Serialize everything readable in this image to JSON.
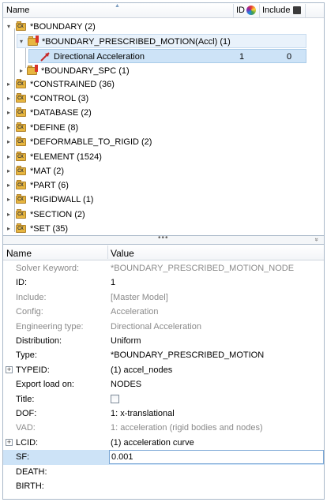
{
  "tree": {
    "columns": {
      "name": "Name",
      "id": "ID",
      "include": "Include"
    },
    "rows": [
      {
        "label": "*BOUNDARY  (2)",
        "state": "expanded"
      },
      {
        "label": "*BOUNDARY_PRESCRIBED_MOTION(Accl)  (1)",
        "state": "expanded"
      },
      {
        "label": "Directional Acceleration",
        "id": "1",
        "include": "0",
        "selected": true
      },
      {
        "label": "*BOUNDARY_SPC  (1)",
        "state": "collapsed"
      },
      {
        "label": "*CONSTRAINED  (36)",
        "state": "collapsed"
      },
      {
        "label": "*CONTROL  (3)",
        "state": "collapsed"
      },
      {
        "label": "*DATABASE  (2)",
        "state": "collapsed"
      },
      {
        "label": "*DEFINE  (8)",
        "state": "collapsed"
      },
      {
        "label": "*DEFORMABLE_TO_RIGID  (2)",
        "state": "collapsed"
      },
      {
        "label": "*ELEMENT  (1524)",
        "state": "collapsed"
      },
      {
        "label": "*MAT  (2)",
        "state": "collapsed"
      },
      {
        "label": "*PART  (6)",
        "state": "collapsed"
      },
      {
        "label": "*RIGIDWALL  (1)",
        "state": "collapsed"
      },
      {
        "label": "*SECTION  (2)",
        "state": "collapsed"
      },
      {
        "label": "*SET  (35)",
        "state": "collapsed"
      }
    ],
    "folder_icon_text": "CX"
  },
  "splitter": {
    "dots": "•••",
    "chevron": "»"
  },
  "props": {
    "columns": {
      "name": "Name",
      "value": "Value"
    },
    "rows": [
      {
        "name": "Solver Keyword:",
        "value": "*BOUNDARY_PRESCRIBED_MOTION_NODE",
        "dim": true
      },
      {
        "name": "ID:",
        "value": "1"
      },
      {
        "name": "Include:",
        "value": "[Master Model]",
        "dim": true
      },
      {
        "name": "Config:",
        "value": "Acceleration",
        "dim": true
      },
      {
        "name": "Engineering type:",
        "value": "Directional Acceleration",
        "dim": true
      },
      {
        "name": "Distribution:",
        "value": "Uniform"
      },
      {
        "name": "Type:",
        "value": "*BOUNDARY_PRESCRIBED_MOTION"
      },
      {
        "name": "TYPEID:",
        "value": "(1) accel_nodes",
        "expandable": true
      },
      {
        "name": "Export load on:",
        "value": "NODES"
      },
      {
        "name": "Title:",
        "value": "",
        "checkbox": true
      },
      {
        "name": "DOF:",
        "value": "1: x-translational"
      },
      {
        "name": "VAD:",
        "value": "1: acceleration (rigid bodies and nodes)",
        "dim": true
      },
      {
        "name": "LCID:",
        "value": "(1) acceleration curve",
        "expandable": true
      },
      {
        "name": "SF:",
        "value": "0.001",
        "editing": true
      },
      {
        "name": "DEATH:",
        "value": ""
      },
      {
        "name": "BIRTH:",
        "value": ""
      }
    ]
  },
  "colors": {
    "selection": "#cde3f7",
    "folder": "#e7b640",
    "accent_red": "#d9342b"
  }
}
